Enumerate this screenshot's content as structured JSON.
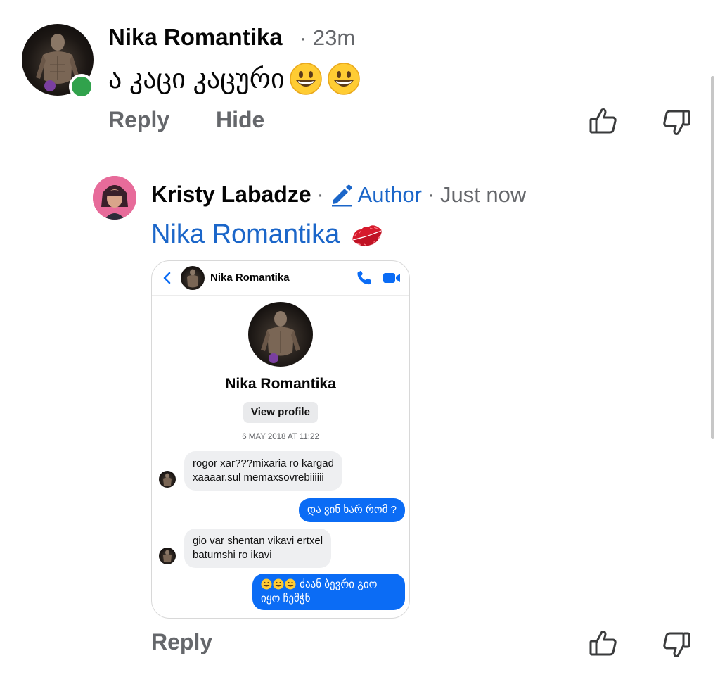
{
  "comment": {
    "author": "Nika Romantika",
    "time": "· 23m",
    "text": "ა კაცი კაცური",
    "emojis": [
      "grinning-face",
      "grinning-face"
    ],
    "actions": {
      "reply": "Reply",
      "hide": "Hide"
    }
  },
  "reply": {
    "author": "Kristy Labadze",
    "separator": "·",
    "badge": "Author",
    "time": "Just now",
    "mention": "Nika Romantika",
    "mention_emoji": "kiss-mark",
    "actions": {
      "reply": "Reply"
    }
  },
  "screenshot": {
    "header_name": "Nika Romantika",
    "profile_name": "Nika Romantika",
    "view_profile": "View profile",
    "date": "6 MAY 2018 AT 11:22",
    "messages": [
      {
        "direction": "in",
        "lines": [
          "rogor xar???mixaria ro kargad",
          "xaaaar.sul memaxsovrebiiiiii"
        ]
      },
      {
        "direction": "out",
        "lines": [
          "და ვინ ხარ რომ ?"
        ]
      },
      {
        "direction": "in",
        "lines": [
          "gio var shentan vikavi ertxel",
          "batumshi ro ikavi"
        ]
      },
      {
        "direction": "out",
        "emojis": 3,
        "lines": [
          "ძაან ბევრი გიო",
          "იყო ჩემჭნ"
        ]
      }
    ]
  },
  "colors": {
    "link_blue": "#1b66c9",
    "messenger_blue": "#0b6cf5",
    "online_green": "#31a24c",
    "secondary_text": "#65676b"
  }
}
